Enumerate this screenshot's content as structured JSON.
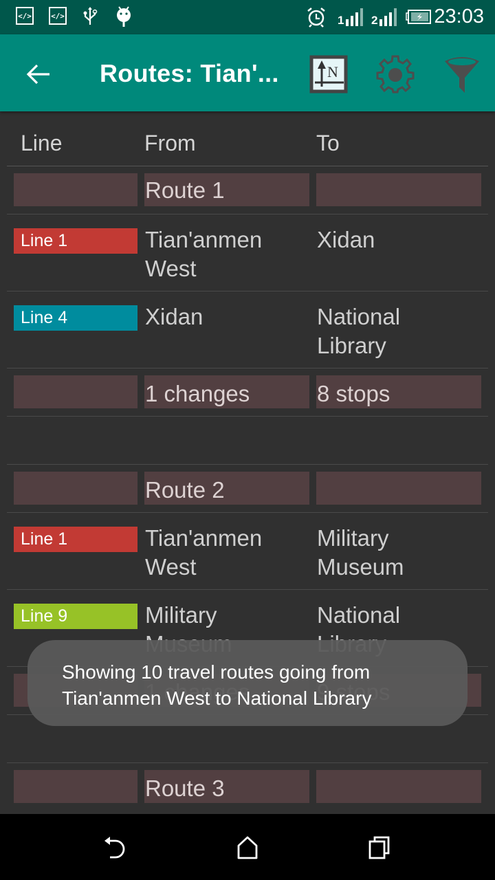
{
  "status_bar": {
    "left_icons": [
      "code-icon",
      "code-icon",
      "usb-icon",
      "android-debug-icon"
    ],
    "code_glyph": "</>",
    "right_icons": [
      "alarm-icon",
      "signal-sim1-icon",
      "signal-sim2-icon",
      "battery-charging-icon"
    ],
    "sim1_label": "1",
    "sim2_label": "2",
    "time": "23:03"
  },
  "app_bar": {
    "title": "Routes: Tian'...",
    "back_icon": "arrow-back-icon",
    "actions": [
      {
        "name": "north-orientation",
        "icon": "north-arrow-icon",
        "glyph": "N"
      },
      {
        "name": "settings",
        "icon": "gear-icon"
      },
      {
        "name": "filter",
        "icon": "funnel-icon"
      }
    ]
  },
  "table": {
    "columns": [
      "Line",
      "From",
      "To"
    ],
    "routes": [
      {
        "title": "Route 1",
        "legs": [
          {
            "line": "Line 1",
            "color": "#c23a34",
            "from": [
              "Tian'anmen",
              "West"
            ],
            "to": [
              "Xidan"
            ]
          },
          {
            "line": "Line 4",
            "color": "#008c9e",
            "from": [
              "Xidan"
            ],
            "to": [
              "National",
              "Library"
            ]
          }
        ],
        "changes": "1 changes",
        "stops": "8 stops"
      },
      {
        "title": "Route 2",
        "legs": [
          {
            "line": "Line 1",
            "color": "#c23a34",
            "from": [
              "Tian'anmen",
              "West"
            ],
            "to": [
              "Military",
              "Museum"
            ]
          },
          {
            "line": "Line 9",
            "color": "#97c227",
            "from": [
              "Military",
              "Museum"
            ],
            "to": [
              "National",
              "Library"
            ]
          }
        ],
        "changes": "1 changes",
        "stops": "9 stops"
      },
      {
        "title": "Route 3"
      }
    ]
  },
  "toast": {
    "line1": "Showing 10 travel routes going from",
    "line2": "Tian'anmen West to National Library"
  },
  "nav_bar": {
    "buttons": [
      "back",
      "home",
      "recents"
    ]
  }
}
